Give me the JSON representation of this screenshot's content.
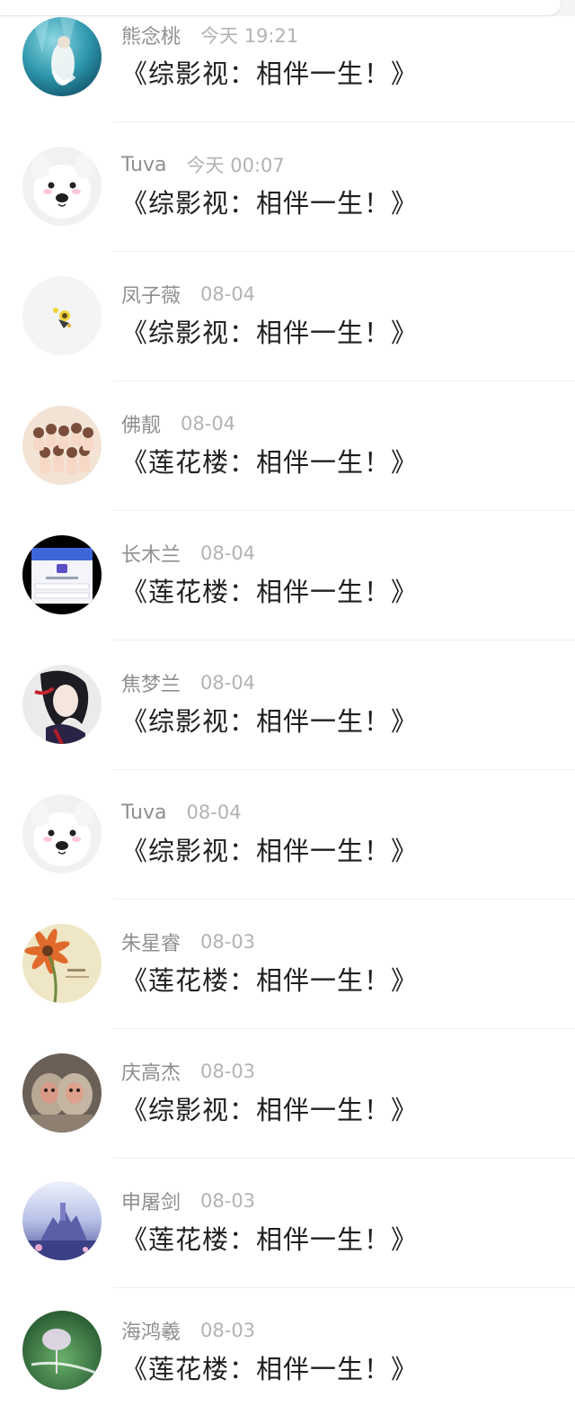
{
  "conversations": [
    {
      "name": "熊念桃",
      "time": "今天 19:21",
      "message": "《综影视：相伴一生！》",
      "avatar_icon": "underwater-figure-avatar"
    },
    {
      "name": "Tuva",
      "time": "今天 00:07",
      "message": "《综影视：相伴一生！》",
      "avatar_icon": "white-dog-avatar"
    },
    {
      "name": "凤子薇",
      "time": "08-04",
      "message": "《综影视：相伴一生！》",
      "avatar_icon": "small-cartoon-avatar"
    },
    {
      "name": "佛靓",
      "time": "08-04",
      "message": "《莲花楼：相伴一生！》",
      "avatar_icon": "group-photo-avatar"
    },
    {
      "name": "长木兰",
      "time": "08-04",
      "message": "《莲花楼：相伴一生！》",
      "avatar_icon": "phone-screenshot-avatar"
    },
    {
      "name": "焦梦兰",
      "time": "08-04",
      "message": "《综影视：相伴一生！》",
      "avatar_icon": "anime-character-avatar"
    },
    {
      "name": "Tuva",
      "time": "08-04",
      "message": "《综影视：相伴一生！》",
      "avatar_icon": "white-dog-avatar"
    },
    {
      "name": "朱星睿",
      "time": "08-03",
      "message": "《莲花楼：相伴一生！》",
      "avatar_icon": "flower-avatar"
    },
    {
      "name": "庆高杰",
      "time": "08-03",
      "message": "《综影视：相伴一生！》",
      "avatar_icon": "monkeys-avatar"
    },
    {
      "name": "申屠剑",
      "time": "08-03",
      "message": "《莲花楼：相伴一生！》",
      "avatar_icon": "fantasy-castle-avatar"
    },
    {
      "name": "海鸿羲",
      "time": "08-03",
      "message": "《莲花楼：相伴一生！》",
      "avatar_icon": "jellyfish-umbrella-avatar"
    }
  ]
}
